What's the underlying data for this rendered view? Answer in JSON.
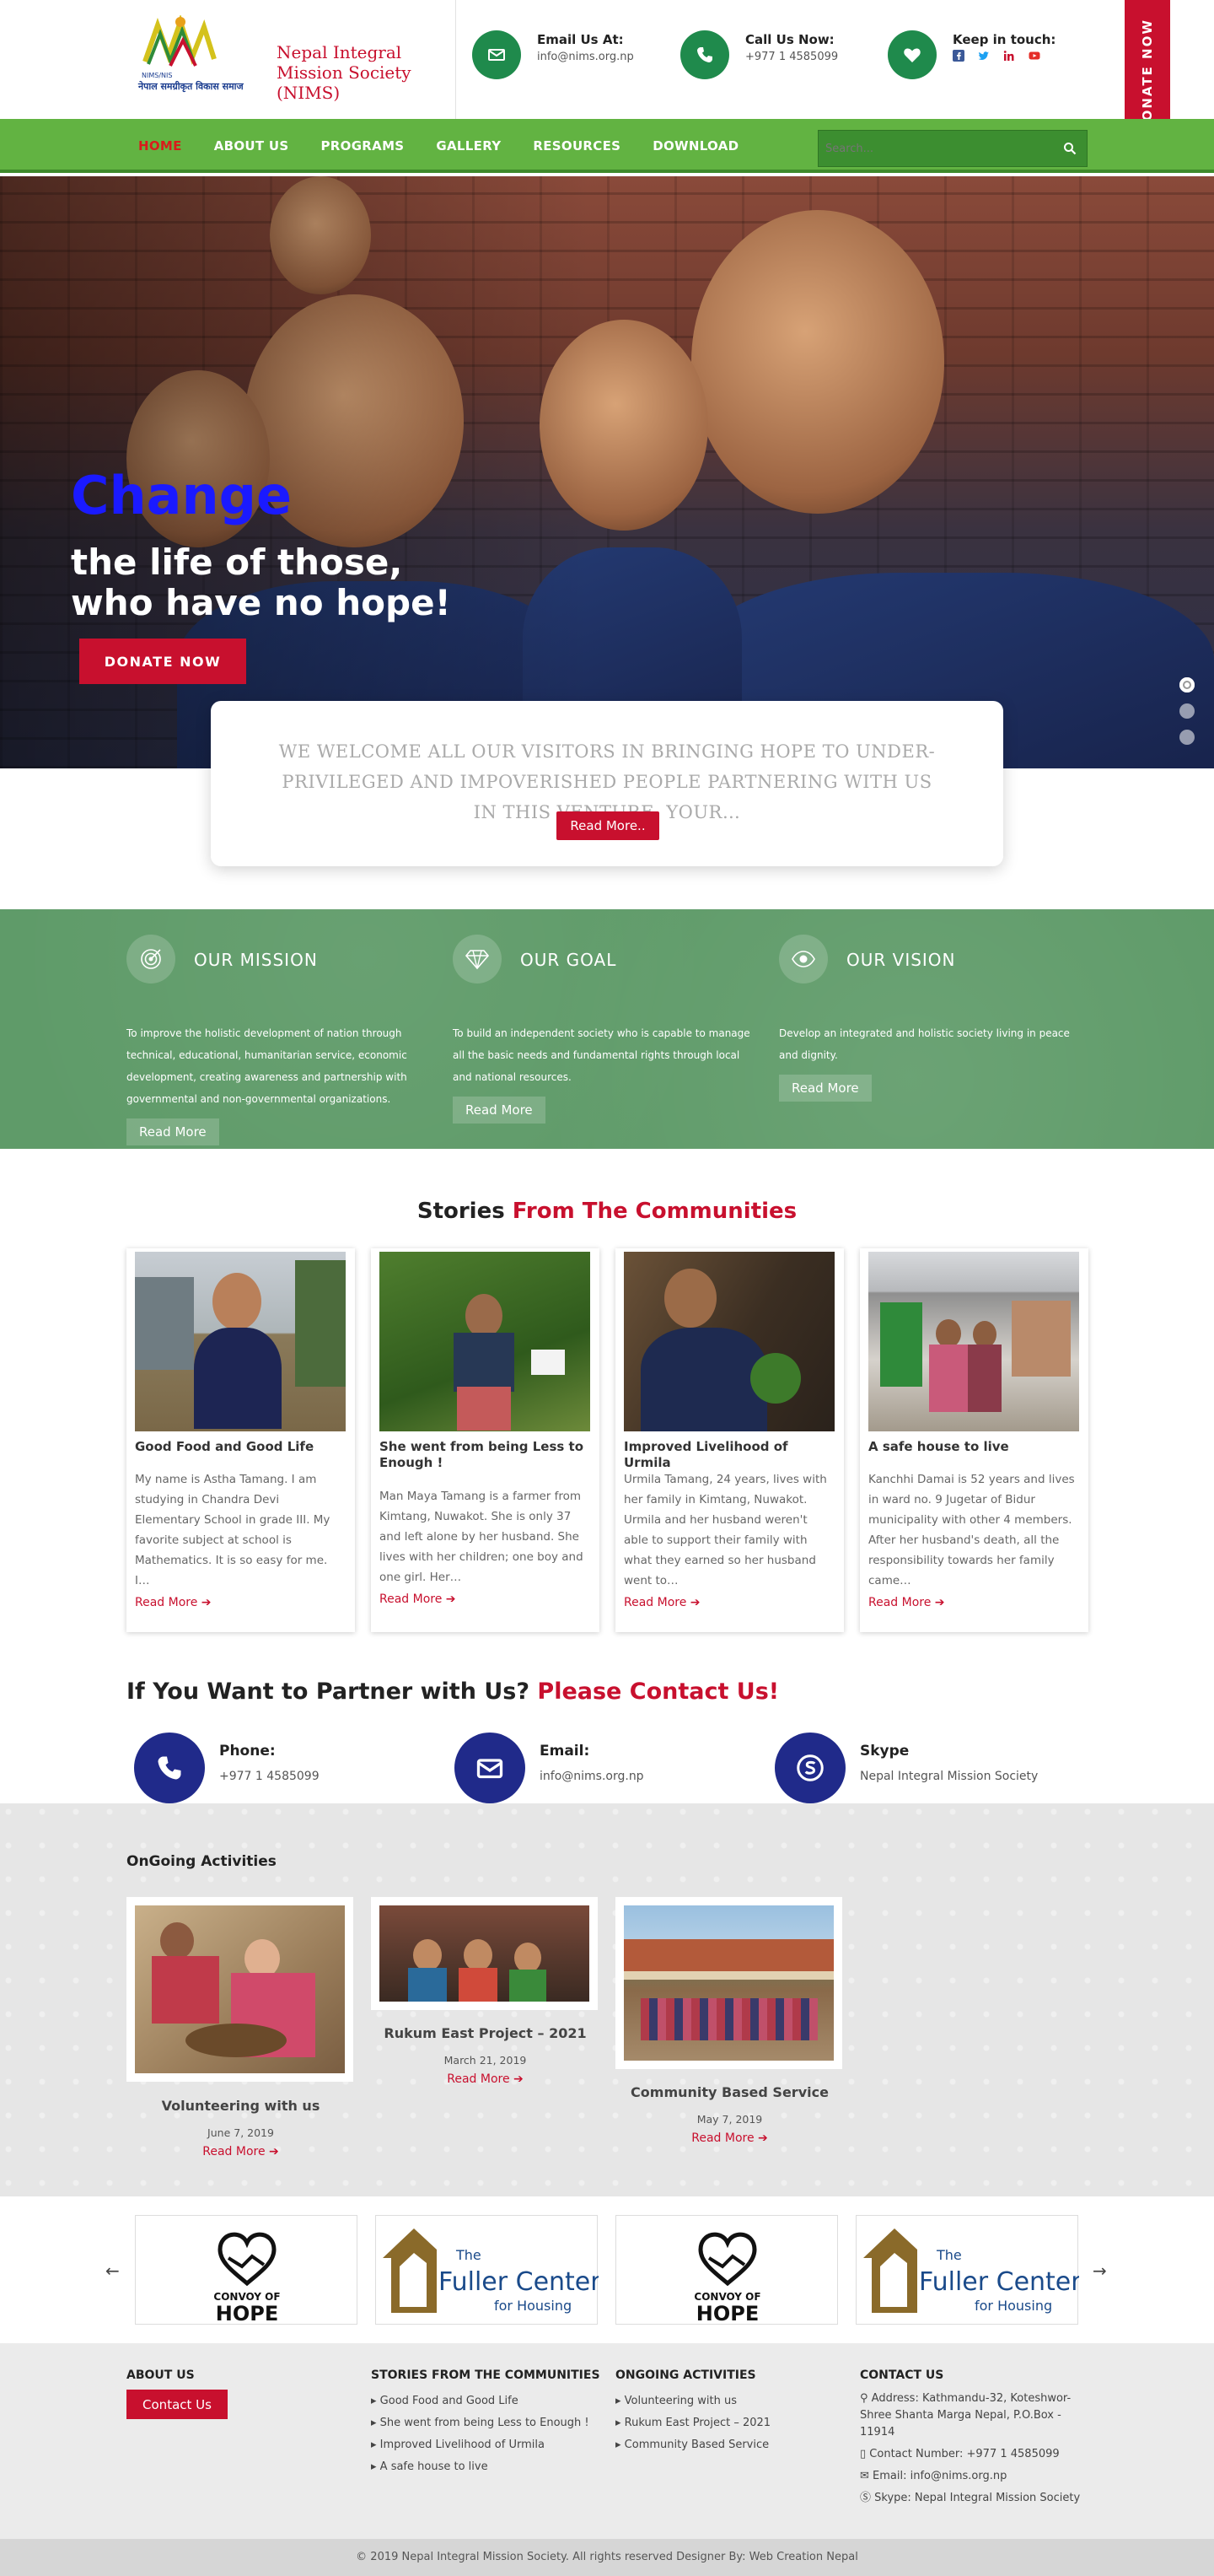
{
  "header": {
    "logo_name_line1": "Nepal Integral",
    "logo_name_line2": "Mission Society",
    "logo_name_line3": "(NIMS)",
    "logo_nepali": "नेपाल समग्रीकृत विकास समाज",
    "logo_small": "NIMS/NIS",
    "email_title": "Email Us At:",
    "email_value": "info@nims.org.np",
    "call_title": "Call Us Now:",
    "call_value": "+977 1 4585099",
    "touch_title": "Keep in touch:",
    "donate_tab": "DONATE NOW"
  },
  "nav": {
    "items": [
      "HOME",
      "ABOUT US",
      "PROGRAMS",
      "GALLERY",
      "RESOURCES",
      "DOWNLOAD"
    ],
    "search_placeholder": "Search..."
  },
  "hero": {
    "headline": "Change",
    "sub_line1": "the life of those,",
    "sub_line2": "who have no hope!",
    "button": "DONATE NOW"
  },
  "welcome": {
    "text": "WE WELCOME ALL OUR VISITORS IN BRINGING HOPE TO UNDER-PRIVILEGED AND IMPOVERISHED PEOPLE PARTNERING WITH US IN THIS VENTURE. YOUR…",
    "button": "Read More.."
  },
  "mission": [
    {
      "title": "OUR MISSION",
      "text": "To improve the holistic development of nation through technical, educational, humanitarian service, economic development, creating awareness and partnership with governmental and non-governmental organizations.",
      "button": "Read More"
    },
    {
      "title": "OUR GOAL",
      "text": "To build an independent society who is capable to manage all the basic needs and fundamental rights through local and national resources.",
      "button": "Read More"
    },
    {
      "title": "OUR VISION",
      "text": "Develop an integrated and holistic society living in peace and dignity.",
      "button": "Read More"
    }
  ],
  "stories": {
    "title_black": "Stories",
    "title_red": "From The Communities",
    "cards": [
      {
        "title": "Good Food and Good Life",
        "text": "My name is Astha Tamang. I am studying in Chandra Devi Elementary School in grade III. My favorite subject at school is Mathematics. It is so easy for me. I…",
        "more": "Read More"
      },
      {
        "title": "She went from being Less to Enough !",
        "text": "Man Maya Tamang is a farmer from Kimtang, Nuwakot. She is only 37 and left alone by her husband. She lives with her children; one boy and one girl. Her…",
        "more": "Read More"
      },
      {
        "title": "Improved Livelihood of Urmila",
        "text": "Urmila Tamang, 24 years, lives with her family in Kimtang, Nuwakot. Urmila and her husband weren't able to support their family with what they earned so her husband went to…",
        "more": "Read More"
      },
      {
        "title": "A safe house to live",
        "text": "Kanchhi Damai is 52 years and lives in ward no. 9 Jugetar of Bidur municipality with other 4 members. After her husband's death, all the responsibility towards her family came…",
        "more": "Read More"
      }
    ]
  },
  "partner": {
    "title_black": "If You Want to Partner with Us?",
    "title_red": "Please Contact Us!",
    "items": [
      {
        "label": "Phone:",
        "value": "+977 1 4585099"
      },
      {
        "label": "Email:",
        "value": "info@nims.org.np"
      },
      {
        "label": "Skype",
        "value": "Nepal Integral Mission Society"
      }
    ]
  },
  "ongoing": {
    "title": "OnGoing Activities",
    "items": [
      {
        "title": "Volunteering with us",
        "date": "June 7, 2019",
        "more": "Read More"
      },
      {
        "title": "Rukum East Project – 2021",
        "date": "March 21, 2019",
        "more": "Read More"
      },
      {
        "title": "Community Based Service",
        "date": "May 7, 2019",
        "more": "Read More"
      }
    ]
  },
  "logos": {
    "convoy_line1": "CONVOY OF",
    "convoy_line2": "HOPE",
    "fuller_the": "The",
    "fuller_name": "Fuller Center",
    "fuller_sub": "for Housing",
    "prev": "←",
    "next": "→"
  },
  "footer": {
    "about_title": "ABOUT US",
    "about_button": "Contact Us",
    "stories_title": "STORIES FROM THE COMMUNITIES",
    "stories_links": [
      "Good Food and Good Life",
      "She went from being Less to Enough !",
      "Improved Livelihood of Urmila",
      "A safe house to live"
    ],
    "ongoing_title": "ONGOING ACTIVITIES",
    "ongoing_links": [
      "Volunteering with us",
      "Rukum East Project – 2021",
      "Community Based Service"
    ],
    "contact_title": "CONTACT US",
    "address_line1": "Address: Kathmandu-32, Koteshwor-",
    "address_line2": "Shree Shanta Marga Nepal, P.O.Box -",
    "address_line3": "11914",
    "contact_number": "Contact Number: +977 1 4585099",
    "email": "Email: info@nims.org.np",
    "skype": "Skype: Nepal Integral Mission Society",
    "copyright": "© 2019 Nepal Integral Mission Society. All rights reserved Designer By: Web Creation Nepal"
  },
  "colors": {
    "brand_red": "#c8102e",
    "nav_green": "#62b342",
    "icon_green": "#1f8a4c",
    "mission_green": "#5f9b69",
    "partner_navy": "#202a8a"
  }
}
